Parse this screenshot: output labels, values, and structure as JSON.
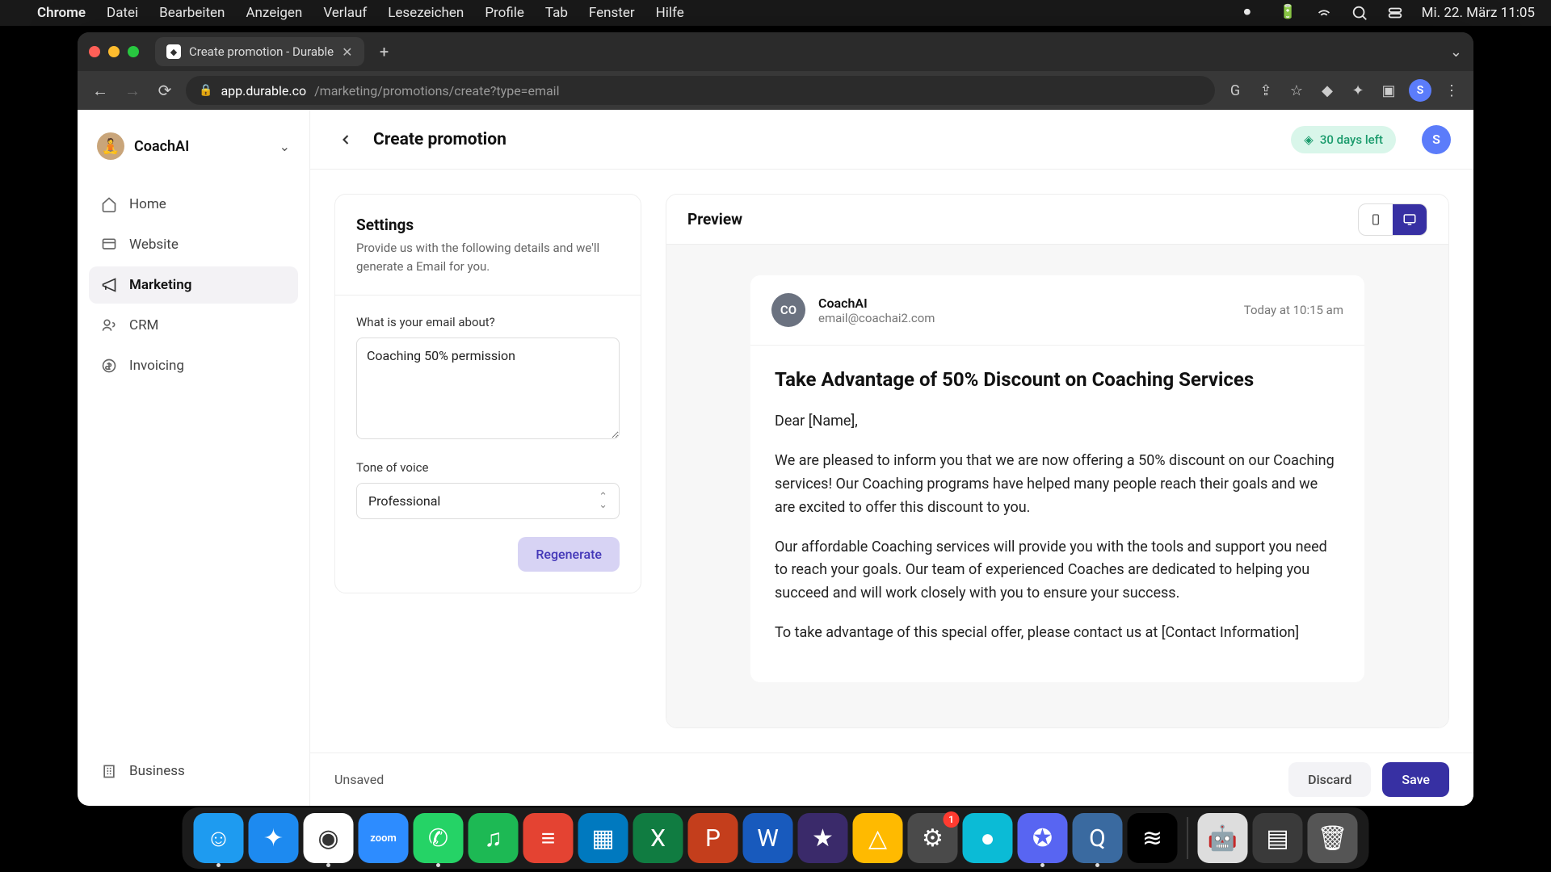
{
  "menubar": {
    "app": "Chrome",
    "items": [
      "Datei",
      "Bearbeiten",
      "Anzeigen",
      "Verlauf",
      "Lesezeichen",
      "Profile",
      "Tab",
      "Fenster",
      "Hilfe"
    ],
    "datetime": "Mi. 22. März  11:05"
  },
  "browser": {
    "tab_title": "Create promotion - Durable",
    "url_domain": "app.durable.co",
    "url_path": "/marketing/promotions/create?type=email",
    "profile_initial": "S"
  },
  "sidebar": {
    "workspace": "CoachAI",
    "items": [
      {
        "icon": "home",
        "label": "Home"
      },
      {
        "icon": "website",
        "label": "Website"
      },
      {
        "icon": "marketing",
        "label": "Marketing",
        "active": true
      },
      {
        "icon": "crm",
        "label": "CRM"
      },
      {
        "icon": "invoicing",
        "label": "Invoicing"
      }
    ],
    "business_label": "Business"
  },
  "header": {
    "title": "Create promotion",
    "trial": "30 days left",
    "user_initial": "S"
  },
  "settings": {
    "title": "Settings",
    "subtitle": "Provide us with the following details and we'll generate a Email for you.",
    "about_label": "What is your email about?",
    "about_value": "Coaching 50% permission",
    "tone_label": "Tone of voice",
    "tone_value": "Professional",
    "regenerate": "Regenerate"
  },
  "preview": {
    "title": "Preview",
    "sender_avatar": "CO",
    "sender_name": "CoachAI",
    "sender_email": "email@coachai2.com",
    "timestamp": "Today at 10:15 am",
    "subject": "Take Advantage of 50% Discount on Coaching Services",
    "greeting": "Dear [Name],",
    "p1": "We are pleased to inform you that we are now offering a 50% discount on our Coaching services! Our Coaching programs have helped many people reach their goals and we are excited to offer this discount to you.",
    "p2": "Our affordable Coaching services will provide you with the tools and support you need to reach your goals. Our team of experienced Coaches are dedicated to helping you succeed and will work closely with you to ensure your success.",
    "p3": "To take advantage of this special offer, please contact us at [Contact Information]"
  },
  "footer": {
    "status": "Unsaved",
    "discard": "Discard",
    "save": "Save"
  },
  "dock": {
    "apps": [
      {
        "name": "finder",
        "color": "#1e9bf0",
        "glyph": "☺",
        "running": true
      },
      {
        "name": "safari",
        "color": "#1d8af0",
        "glyph": "✦"
      },
      {
        "name": "chrome",
        "color": "#fff",
        "glyph": "◉",
        "running": true
      },
      {
        "name": "zoom",
        "color": "#2d8cff",
        "glyph": "zoom",
        "text": true
      },
      {
        "name": "whatsapp",
        "color": "#25d366",
        "glyph": "✆",
        "running": true
      },
      {
        "name": "spotify",
        "color": "#1db954",
        "glyph": "♫"
      },
      {
        "name": "todoist",
        "color": "#e44332",
        "glyph": "≡"
      },
      {
        "name": "trello",
        "color": "#0079bf",
        "glyph": "▦"
      },
      {
        "name": "excel",
        "color": "#107c41",
        "glyph": "X"
      },
      {
        "name": "powerpoint",
        "color": "#c43e1c",
        "glyph": "P"
      },
      {
        "name": "word",
        "color": "#185abd",
        "glyph": "W"
      },
      {
        "name": "imovie",
        "color": "#3a2a6a",
        "glyph": "★"
      },
      {
        "name": "drive",
        "color": "#ffba00",
        "glyph": "△"
      },
      {
        "name": "settings",
        "color": "#4a4a4a",
        "glyph": "⚙",
        "badge": "1"
      },
      {
        "name": "siri",
        "color": "#0bbbd6",
        "glyph": "●"
      },
      {
        "name": "discord",
        "color": "#5865f2",
        "glyph": "✪",
        "running": true
      },
      {
        "name": "quicktime",
        "color": "#3a6aa0",
        "glyph": "Q",
        "running": true
      },
      {
        "name": "voice",
        "color": "#000",
        "glyph": "≋"
      }
    ],
    "tray": [
      {
        "name": "automator",
        "color": "#ddd",
        "glyph": "🤖"
      },
      {
        "name": "folder",
        "color": "#3a3a3a",
        "glyph": "▤"
      },
      {
        "name": "trash",
        "color": "#555",
        "glyph": "🗑"
      }
    ]
  }
}
